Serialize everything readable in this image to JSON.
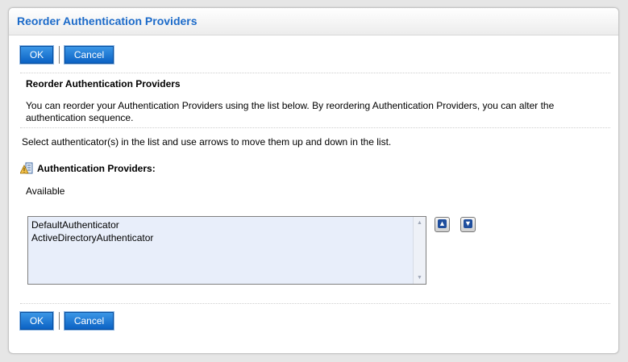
{
  "title": "Reorder Authentication Providers",
  "buttons": {
    "ok_label": "OK",
    "cancel_label": "Cancel"
  },
  "section": {
    "heading": "Reorder Authentication Providers",
    "description_line1": "You can reorder your Authentication Providers using the list below. By reordering Authentication Providers, you can alter the",
    "description_line2": "authentication sequence."
  },
  "instruction": "Select authenticator(s) in the list and use arrows to move them up and down in the list.",
  "providers": {
    "label": "Authentication Providers:",
    "available_label": "Available",
    "items": [
      "DefaultAuthenticator",
      "ActiveDirectoryAuthenticator"
    ]
  },
  "colors": {
    "title": "#1b6ac9",
    "button": "#0b62c4",
    "list_bg": "#e8eefa"
  }
}
